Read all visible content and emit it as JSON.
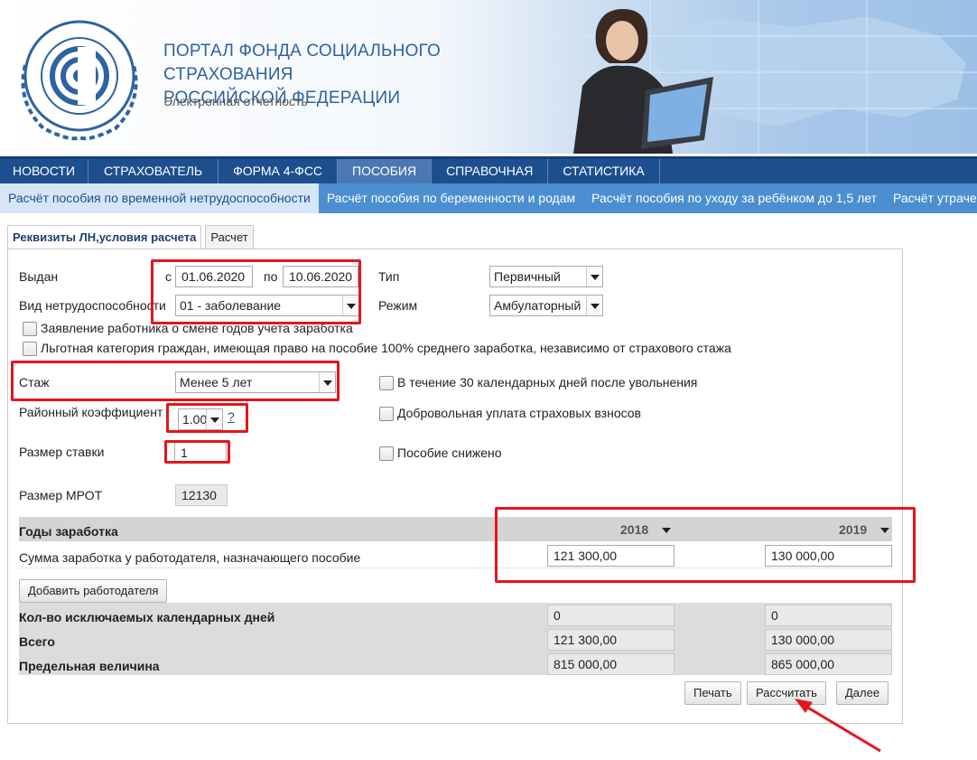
{
  "header": {
    "title_line1": "ПОРТАЛ ФОНДА СОЦИАЛЬНОГО СТРАХОВАНИЯ",
    "title_line2": "РОССИЙСКОЙ ФЕДЕРАЦИИ",
    "subtitle": "Электронная отчетность",
    "logo_text": "ФОНД СОЦИАЛЬНОГО СТРАХОВАНИЯ РОССИЙСКОЙ ФЕДЕРАЦИИ"
  },
  "nav": {
    "items": [
      "НОВОСТИ",
      "СТРАХОВАТЕЛЬ",
      "ФОРМА 4-ФСС",
      "ПОСОБИЯ",
      "СПРАВОЧНАЯ",
      "СТАТИСТИКА"
    ],
    "active": "ПОСОБИЯ"
  },
  "subnav": {
    "items": [
      "Расчёт пособия по временной нетрудоспособности",
      "Расчёт пособия по беременности и родам",
      "Расчёт пособия по уходу за ребёнком до 1,5 лет",
      "Расчёт утраченного заработка"
    ]
  },
  "tabs": [
    "Реквизиты ЛН,условия расчета",
    "Расчет"
  ],
  "form": {
    "issued_label": "Выдан",
    "from_label": "с",
    "from_value": "01.06.2020",
    "to_label": "по",
    "to_value": "10.06.2020",
    "type_label": "Тип",
    "type_value": "Первичный",
    "disability_label": "Вид нетрудоспособности",
    "disability_value": "01 - заболевание",
    "mode_label": "Режим",
    "mode_value": "Амбулаторный",
    "check1_label": "Заявление работника о смене годов учета заработка",
    "check2_label": "Льготная категория граждан, имеющая право на пособие 100% среднего заработка, независимо от страхового стажа",
    "experience_label": "Стаж",
    "experience_value": "Менее 5 лет",
    "check3_label": "В течение 30 календарных дней после увольнения",
    "regional_label": "Районный коэффициент",
    "regional_value": "1.00",
    "help_link": "?",
    "check4_label": "Добровольная уплата страховых взносов",
    "rate_label": "Размер ставки",
    "rate_value": "1",
    "check5_label": "Пособие снижено",
    "mrot_label": "Размер МРОТ",
    "mrot_value": "12130"
  },
  "earnings": {
    "years_label": "Годы заработка",
    "year1": "2018",
    "year2": "2019",
    "sum_label": "Сумма заработка у работодателя, назначающего пособие",
    "sum1": "121 300,00",
    "sum2": "130 000,00",
    "add_employer_button": "Добавить работодателя",
    "excluded_label": "Кол-во исключаемых календарных дней",
    "excluded1": "0",
    "excluded2": "0",
    "total_label": "Всего",
    "total1": "121 300,00",
    "total2": "130 000,00",
    "limit_label": "Предельная величина",
    "limit1": "815 000,00",
    "limit2": "865 000,00"
  },
  "buttons": {
    "print": "Печать",
    "calculate": "Рассчитать",
    "next": "Далее"
  },
  "colors": {
    "nav_bg": "#1d4f8f",
    "subnav_bg": "#4b8fd0",
    "annotation_red": "#e3161b",
    "title_blue": "#2d63a0"
  }
}
